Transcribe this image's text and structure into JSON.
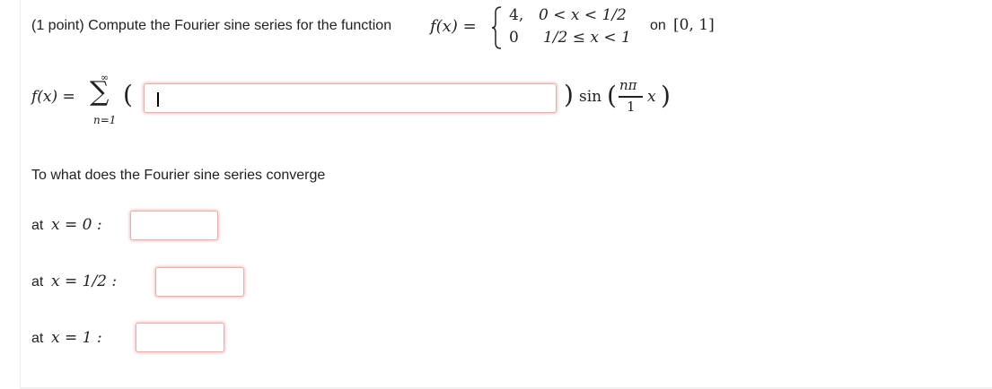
{
  "problem": {
    "intro": "(1 point) Compute the Fourier sine series for the function",
    "f_lhs": "f(x) =",
    "case1_value": "4,",
    "case1_cond": "0 < x < 1/2",
    "case2_value": "0",
    "case2_cond": "1/2 ≤ x < 1",
    "interval_prefix": "on",
    "interval": "[0, 1]"
  },
  "series": {
    "lhs": "f(x) =",
    "sigma_top": "∞",
    "sigma_sym": "∑",
    "sigma_bottom": "n=1",
    "open_paren": "(",
    "close_paren": ")",
    "sin_label": "sin",
    "frac_num": "nπ",
    "frac_den": "1",
    "var": "x",
    "coef_input_value": ""
  },
  "convergence": {
    "question": "To what does the Fourier sine series converge",
    "rows": [
      {
        "prefix": "at",
        "eq": "x = 0 :",
        "value": ""
      },
      {
        "prefix": "at",
        "eq": "x = 1/2 :",
        "value": ""
      },
      {
        "prefix": "at",
        "eq": "x = 1 :",
        "value": ""
      }
    ]
  }
}
